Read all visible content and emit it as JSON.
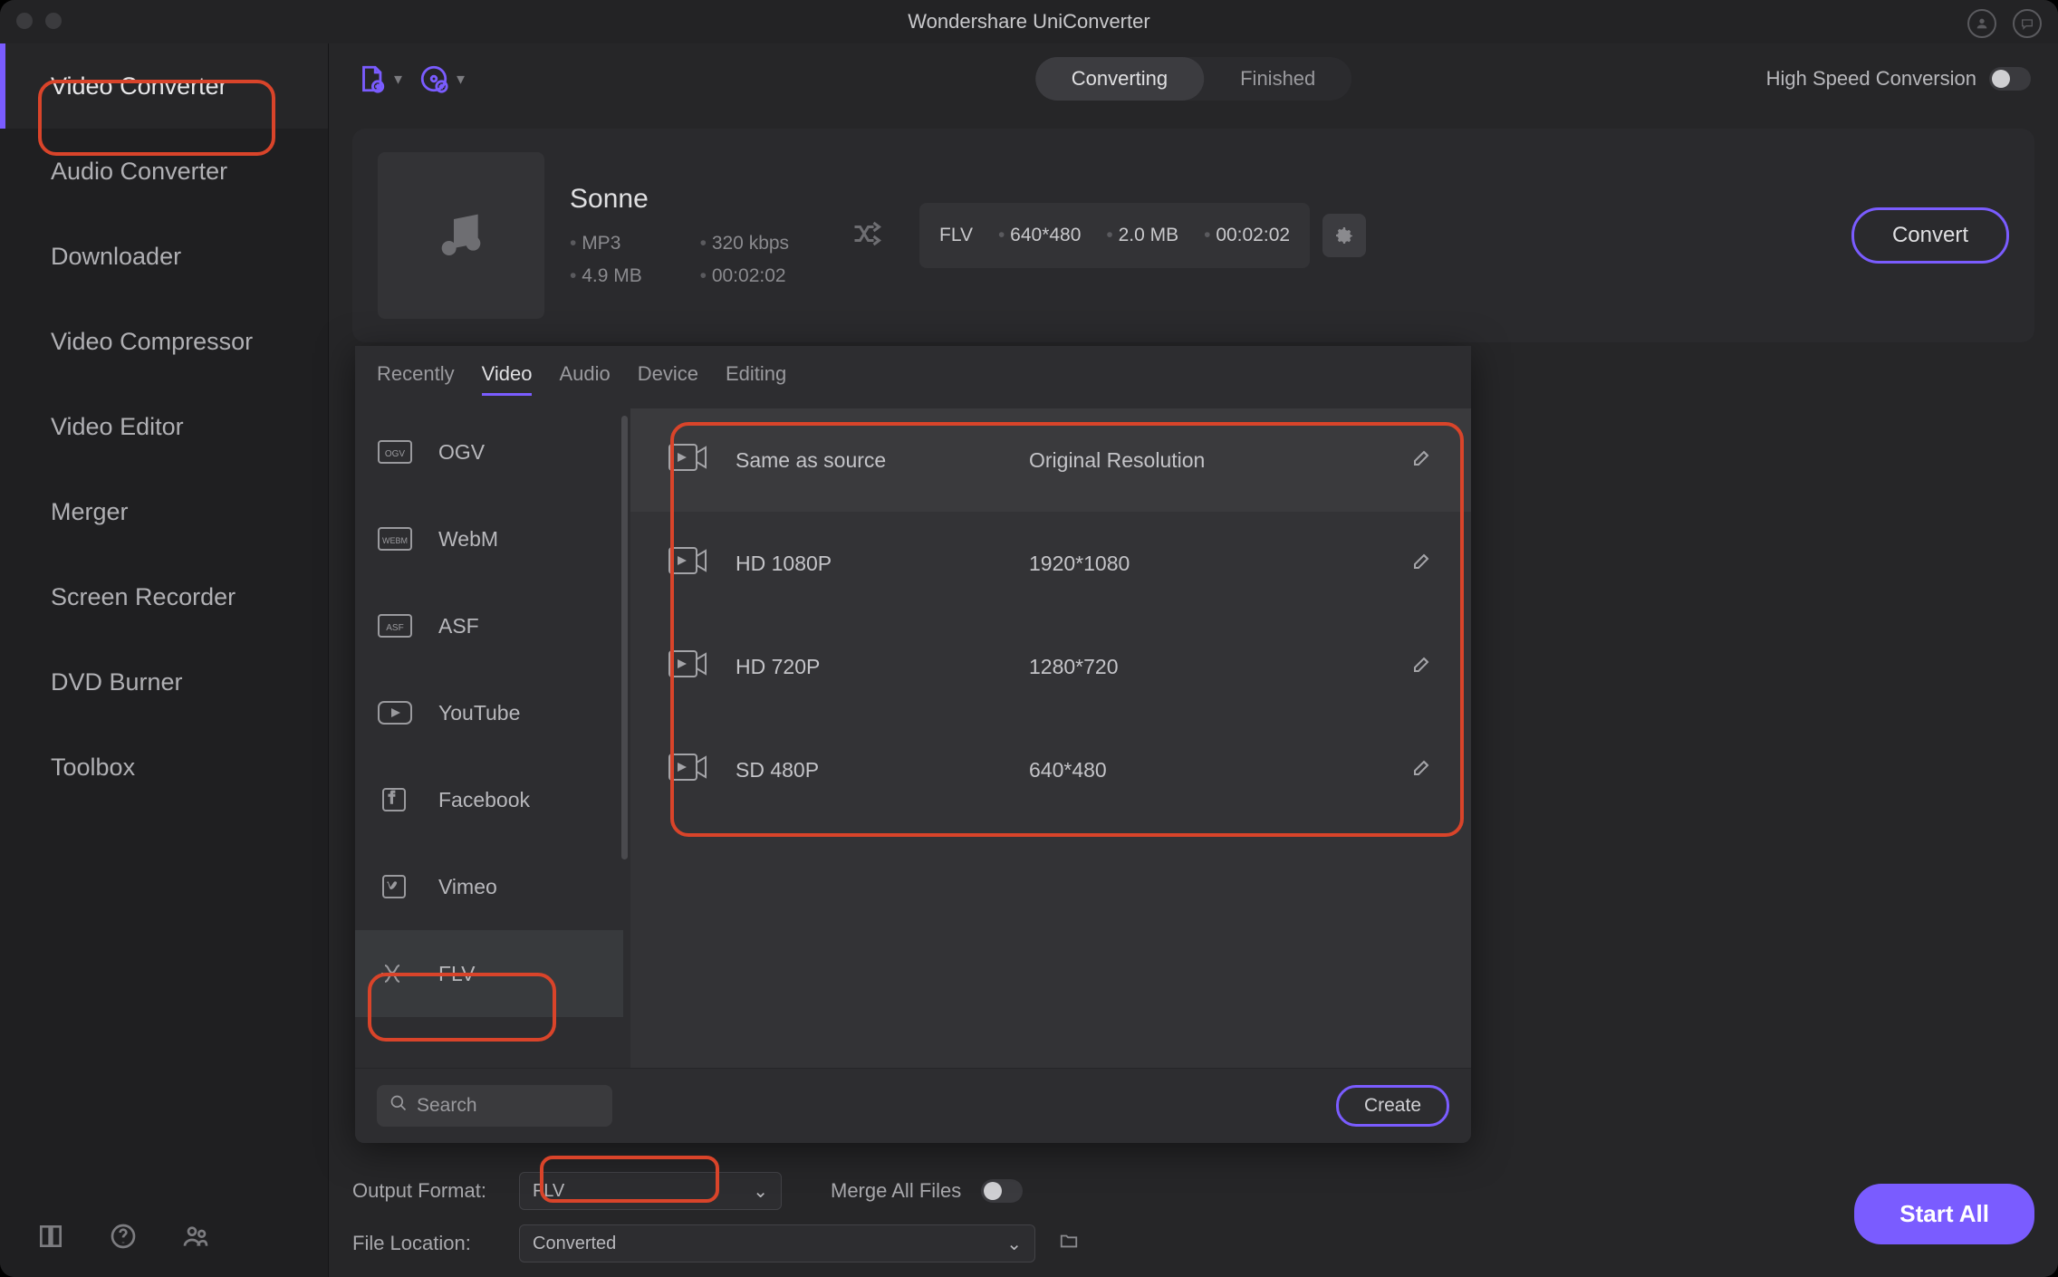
{
  "window": {
    "title": "Wondershare UniConverter"
  },
  "sidebar": {
    "items": [
      {
        "label": "Video Converter",
        "selected": true
      },
      {
        "label": "Audio Converter"
      },
      {
        "label": "Downloader"
      },
      {
        "label": "Video Compressor"
      },
      {
        "label": "Video Editor"
      },
      {
        "label": "Merger"
      },
      {
        "label": "Screen Recorder"
      },
      {
        "label": "DVD Burner"
      },
      {
        "label": "Toolbox"
      }
    ]
  },
  "topbar": {
    "segment": {
      "converting": "Converting",
      "finished": "Finished"
    },
    "highspeed_label": "High Speed Conversion"
  },
  "item": {
    "title": "Sonne",
    "src_format": "MP3",
    "src_bitrate": "320 kbps",
    "src_size": "4.9 MB",
    "src_duration": "00:02:02",
    "dst_format": "FLV",
    "dst_res": "640*480",
    "dst_size": "2.0 MB",
    "dst_duration": "00:02:02",
    "convert_label": "Convert"
  },
  "format_panel": {
    "tabs": [
      "Recently",
      "Video",
      "Audio",
      "Device",
      "Editing"
    ],
    "active_tab": "Video",
    "formats": [
      {
        "label": "OGV",
        "icon": "ogv"
      },
      {
        "label": "WebM",
        "icon": "webm"
      },
      {
        "label": "ASF",
        "icon": "asf"
      },
      {
        "label": "YouTube",
        "icon": "youtube"
      },
      {
        "label": "Facebook",
        "icon": "facebook"
      },
      {
        "label": "Vimeo",
        "icon": "vimeo"
      },
      {
        "label": "FLV",
        "icon": "flv",
        "selected": true
      }
    ],
    "resolutions": [
      {
        "name": "Same as source",
        "res": "Original Resolution"
      },
      {
        "name": "HD 1080P",
        "res": "1920*1080"
      },
      {
        "name": "HD 720P",
        "res": "1280*720"
      },
      {
        "name": "SD 480P",
        "res": "640*480"
      }
    ],
    "search_placeholder": "Search",
    "create_label": "Create"
  },
  "bottom": {
    "output_format_label": "Output Format:",
    "output_format_value": "FLV",
    "merge_label": "Merge All Files",
    "file_location_label": "File Location:",
    "file_location_value": "Converted",
    "start_all_label": "Start All"
  }
}
